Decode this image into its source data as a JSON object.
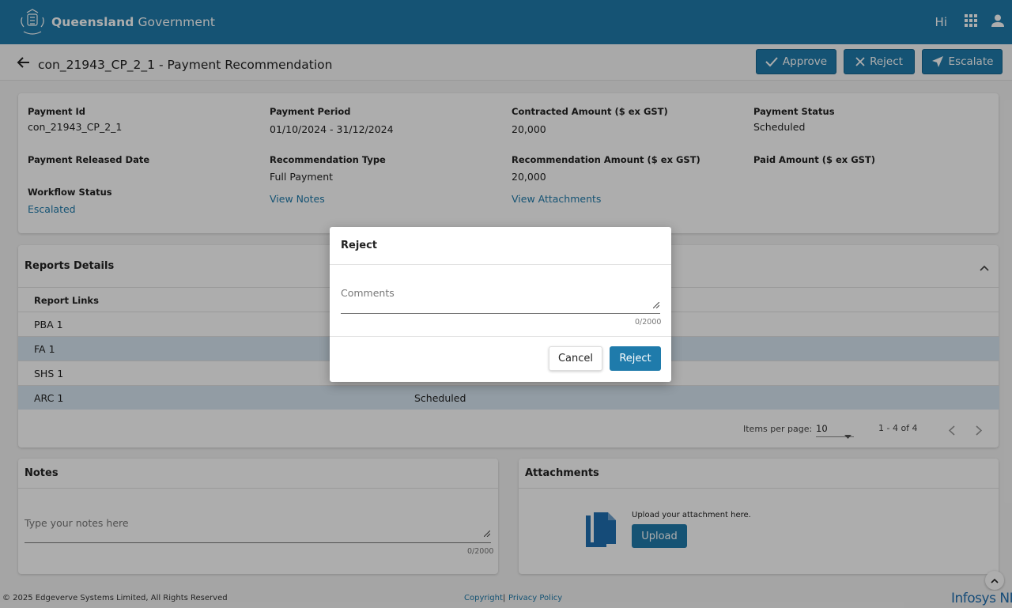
{
  "header": {
    "brand_bold": "Queensland",
    "brand_light": "Government",
    "greeting": "Hi"
  },
  "titlebar": {
    "title": "con_21943_CP_2_1 - Payment Recommendation",
    "approve_label": "Approve",
    "reject_label": "Reject",
    "escalate_label": "Escalate"
  },
  "details": {
    "payment_id_label": "Payment Id",
    "payment_id": "con_21943_CP_2_1",
    "payment_period_label": "Payment Period",
    "payment_period": "01/10/2024 - 31/12/2024",
    "contracted_amount_label": "Contracted Amount ($ ex GST)",
    "contracted_amount": "20,000",
    "payment_status_label": "Payment Status",
    "payment_status": "Scheduled",
    "released_date_label": "Payment Released Date",
    "recommendation_type_label": "Recommendation Type",
    "recommendation_type": "Full Payment",
    "recommendation_amount_label": "Recommendation Amount ($ ex GST)",
    "recommendation_amount": "20,000",
    "paid_amount_label": "Paid Amount ($ ex GST)",
    "workflow_status_label": "Workflow Status",
    "workflow_status": "Escalated",
    "view_notes": "View Notes",
    "view_attachments": "View Attachments"
  },
  "reports": {
    "title": "Reports Details",
    "column_header": "Report Links",
    "rows": [
      {
        "name": "PBA 1",
        "status": ""
      },
      {
        "name": "FA 1",
        "status": ""
      },
      {
        "name": "SHS 1",
        "status": ""
      },
      {
        "name": "ARC 1",
        "status": "Scheduled"
      }
    ],
    "items_per_page_label": "Items per page:",
    "items_per_page": "10",
    "range": "1 - 4 of 4"
  },
  "notes": {
    "title": "Notes",
    "placeholder": "Type your notes here",
    "counter": "0/2000"
  },
  "attachments": {
    "title": "Attachments",
    "hint": "Upload your attachment here.",
    "upload_label": "Upload"
  },
  "dialog": {
    "title": "Reject",
    "comments_placeholder": "Comments",
    "counter": "0/2000",
    "cancel_label": "Cancel",
    "reject_label": "Reject"
  },
  "footer": {
    "copyright_text": "© 2025 Edgeverve Systems Limited, All Rights Reserved",
    "copyright_link": "Copyright",
    "separator": "|",
    "privacy_link": "Privacy Policy",
    "logo_text": "Infosys NIA"
  },
  "colors": {
    "primary": "#1f7bab",
    "alt_row": "#d7e6f2",
    "link": "#1f7bab"
  },
  "icons": [
    "crest-logo",
    "apps-grid-icon",
    "user-icon",
    "back-arrow-icon",
    "check-icon",
    "close-icon",
    "send-icon",
    "chevron-up-icon",
    "chevron-left-icon",
    "chevron-right-icon",
    "dropdown-arrow-icon",
    "document-icon",
    "resize-handle-icon",
    "scroll-top-icon"
  ]
}
